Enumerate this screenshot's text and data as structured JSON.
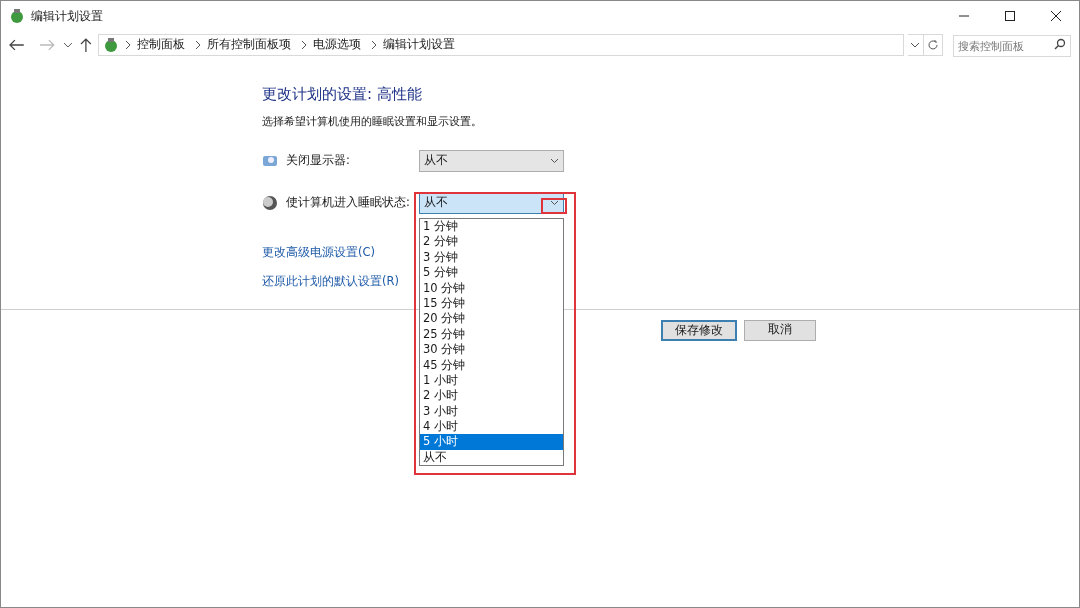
{
  "window": {
    "title": "编辑计划设置"
  },
  "breadcrumb": [
    "控制面板",
    "所有控制面板项",
    "电源选项",
    "编辑计划设置"
  ],
  "search": {
    "placeholder": "搜索控制面板"
  },
  "heading": "更改计划的设置: 高性能",
  "subtitle": "选择希望计算机使用的睡眠设置和显示设置。",
  "settings": [
    {
      "kind": "display",
      "label": "关闭显示器:",
      "value": "从不",
      "expanded": false
    },
    {
      "kind": "sleep",
      "label": "使计算机进入睡眠状态:",
      "value": "从不",
      "expanded": true
    }
  ],
  "links": [
    "更改高级电源设置(C)",
    "还原此计划的默认设置(R)"
  ],
  "options": [
    {
      "label": "1 分钟",
      "selected": false
    },
    {
      "label": "2 分钟",
      "selected": false
    },
    {
      "label": "3 分钟",
      "selected": false
    },
    {
      "label": "5 分钟",
      "selected": false
    },
    {
      "label": "10 分钟",
      "selected": false
    },
    {
      "label": "15 分钟",
      "selected": false
    },
    {
      "label": "20 分钟",
      "selected": false
    },
    {
      "label": "25 分钟",
      "selected": false
    },
    {
      "label": "30 分钟",
      "selected": false
    },
    {
      "label": "45 分钟",
      "selected": false
    },
    {
      "label": "1 小时",
      "selected": false
    },
    {
      "label": "2 小时",
      "selected": false
    },
    {
      "label": "3 小时",
      "selected": false
    },
    {
      "label": "4 小时",
      "selected": false
    },
    {
      "label": "5 小时",
      "selected": true
    },
    {
      "label": "从不",
      "selected": false
    }
  ],
  "buttons": [
    {
      "label": "保存修改",
      "default": true
    },
    {
      "label": "取消",
      "default": false
    }
  ]
}
